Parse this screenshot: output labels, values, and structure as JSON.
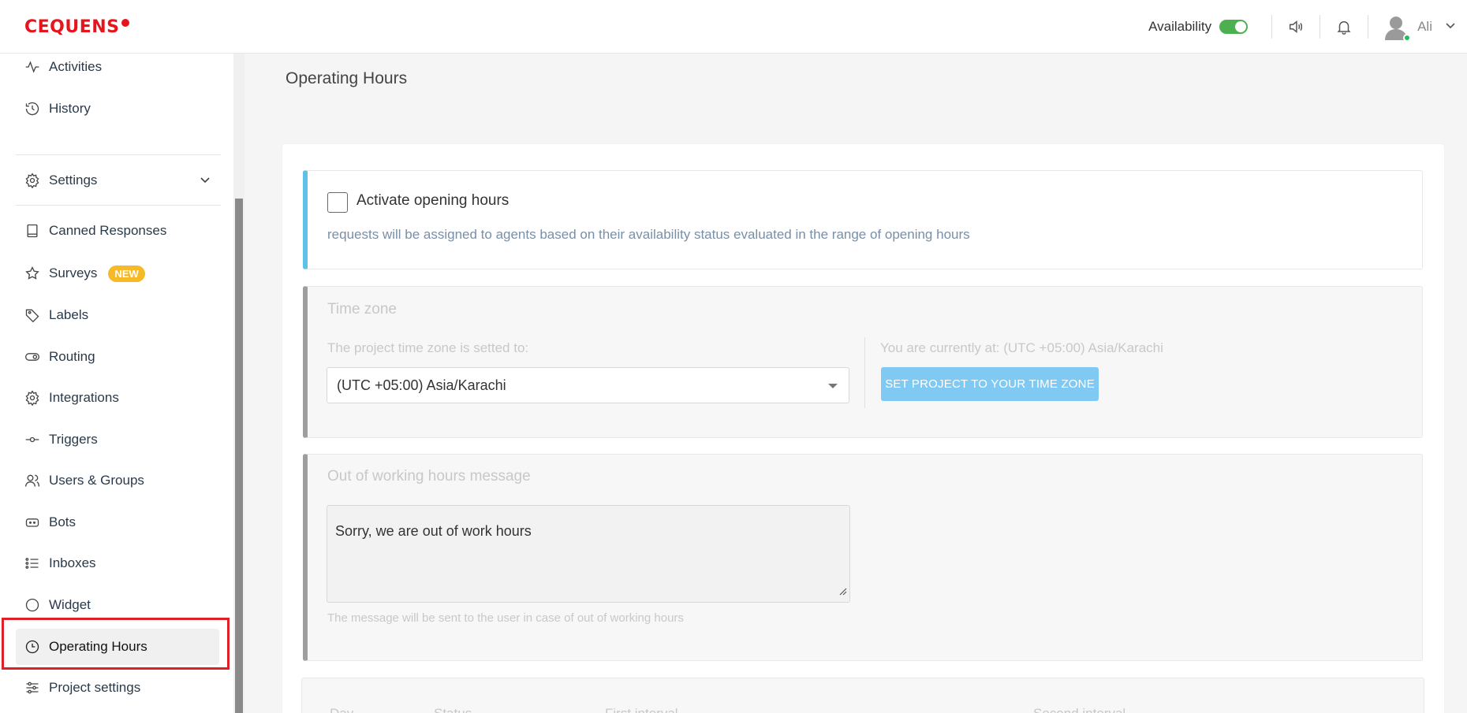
{
  "header": {
    "logo": "CEQUENS",
    "availability_label": "Availability",
    "user_name": "Ali"
  },
  "sidebar": {
    "items": [
      {
        "label": "Activities",
        "icon": "activity-icon"
      },
      {
        "label": "History",
        "icon": "history-icon"
      },
      {
        "label": "Settings",
        "icon": "gear-icon"
      },
      {
        "label": "Canned Responses",
        "icon": "book-icon"
      },
      {
        "label": "Surveys",
        "icon": "star-icon",
        "badge": "NEW"
      },
      {
        "label": "Labels",
        "icon": "tag-icon"
      },
      {
        "label": "Routing",
        "icon": "routing-icon"
      },
      {
        "label": "Integrations",
        "icon": "gear-icon"
      },
      {
        "label": "Triggers",
        "icon": "trigger-icon"
      },
      {
        "label": "Users & Groups",
        "icon": "users-icon"
      },
      {
        "label": "Bots",
        "icon": "bot-icon"
      },
      {
        "label": "Inboxes",
        "icon": "list-icon"
      },
      {
        "label": "Widget",
        "icon": "circle-icon"
      },
      {
        "label": "Operating Hours",
        "icon": "clock-icon",
        "active": true
      },
      {
        "label": "Project settings",
        "icon": "sliders-icon"
      }
    ]
  },
  "main": {
    "page_title": "Operating Hours",
    "activate": {
      "label": "Activate opening hours",
      "description": "requests will be assigned to agents based on their availability status evaluated in the range of opening hours",
      "checked": false
    },
    "timezone": {
      "title": "Time zone",
      "project_label": "The project time zone is setted to:",
      "selected": "(UTC +05:00) Asia/Karachi",
      "current_label": "You are currently at: (UTC +05:00) Asia/Karachi",
      "button": "SET PROJECT TO YOUR TIME ZONE"
    },
    "out_of_hours": {
      "title": "Out of working hours message",
      "message": "Sorry, we are out of work hours",
      "hint": "The message will be sent to the user in case of out of working hours"
    },
    "table": {
      "headers": [
        "Day",
        "Status",
        "First interval",
        "Second interval"
      ]
    }
  },
  "colors": {
    "brand": "#e8141c",
    "accent_blue": "#5ec2e6",
    "button_blue": "#80c9f3",
    "badge": "#f6b927",
    "online": "#1ec05b"
  }
}
